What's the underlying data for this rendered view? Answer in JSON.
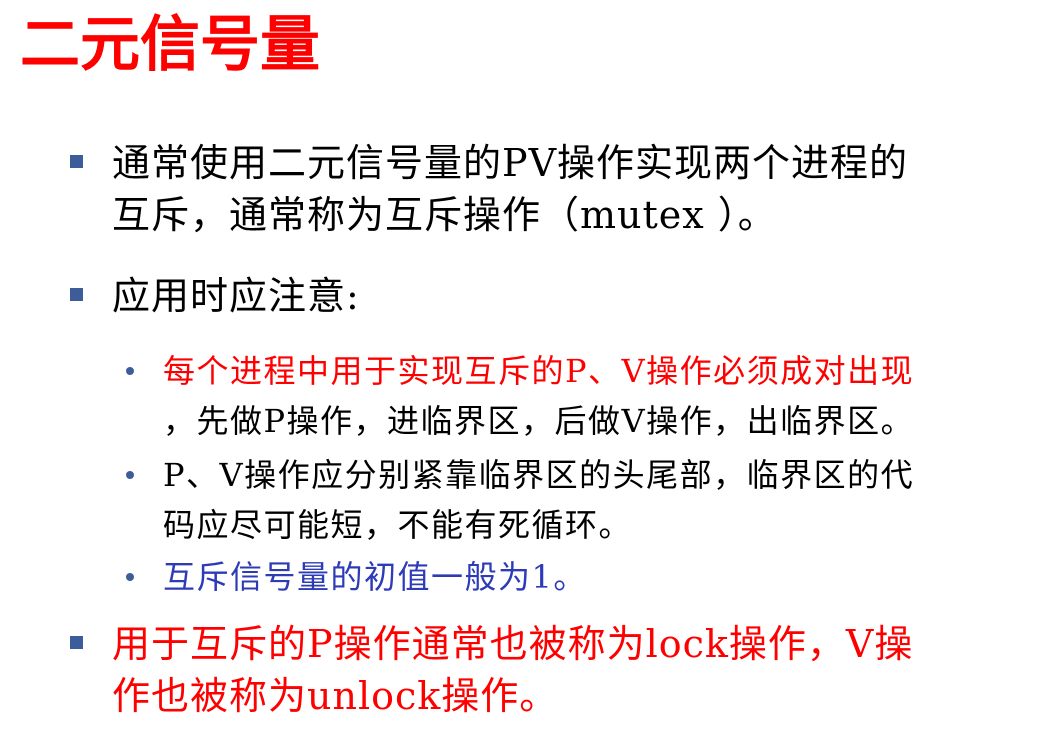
{
  "slide": {
    "title": "二元信号量",
    "bullets": [
      {
        "text_line1": "通常使用二元信号量的PV操作实现两个进程的",
        "text_line2": "互斥，通常称为互斥操作（mutex ）。"
      },
      {
        "text": "应用时应注意:",
        "sub_bullets": [
          {
            "text_line1": "每个进程中用于实现互斥的P、V操作必须成对出现",
            "text_line2": "，先做P操作，进临界区，后做V操作，出临界区。"
          },
          {
            "text_line1": "P、V操作应分别紧靠临界区的头尾部，临界区的代",
            "text_line2": "码应尽可能短，不能有死循环。"
          },
          {
            "text": "互斥信号量的初值一般为1。"
          }
        ]
      },
      {
        "text_line1": "用于互斥的P操作通常也被称为lock操作，V操",
        "text_line2": "作也被称为unlock操作。"
      }
    ]
  },
  "colors": {
    "title": "#ff0000",
    "bullet_marker": "#3d5d9a",
    "red_text": "#ff0000",
    "blue_text": "#2e3bb6",
    "body_text": "#000000"
  }
}
